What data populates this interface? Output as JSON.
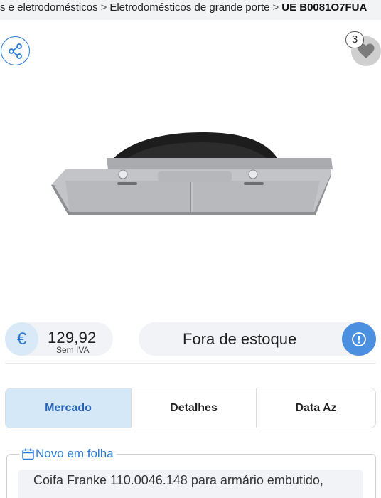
{
  "breadcrumb": {
    "items": [
      "s e eletrodomésticos",
      "Eletrodomésticos de grande porte",
      "UE B0081O7FUA"
    ],
    "separator": ">"
  },
  "actions": {
    "share_icon": "share-icon",
    "favorite_icon": "heart-icon",
    "favorite_count": "3"
  },
  "product": {
    "image_icon": "range-hood-image"
  },
  "price": {
    "currency_symbol": "€",
    "value": "129,92",
    "note": "Sem IVA"
  },
  "stock": {
    "label": "Fora de estoque",
    "info_icon": "exclamation-icon"
  },
  "tabs": [
    {
      "label": "Mercado",
      "active": true
    },
    {
      "label": "Detalhes",
      "active": false
    },
    {
      "label": "Data Az",
      "active": false
    }
  ],
  "section": {
    "title": "Novo em folha",
    "title_icon": "calendar-icon",
    "description": "Coifa Franke 110.0046.148 para armário embutido,"
  },
  "colors": {
    "accent": "#2a7bd8",
    "tab_active_bg": "#d5e8f8",
    "info_button": "#4b8fe0",
    "surface": "#f1f3f6"
  }
}
